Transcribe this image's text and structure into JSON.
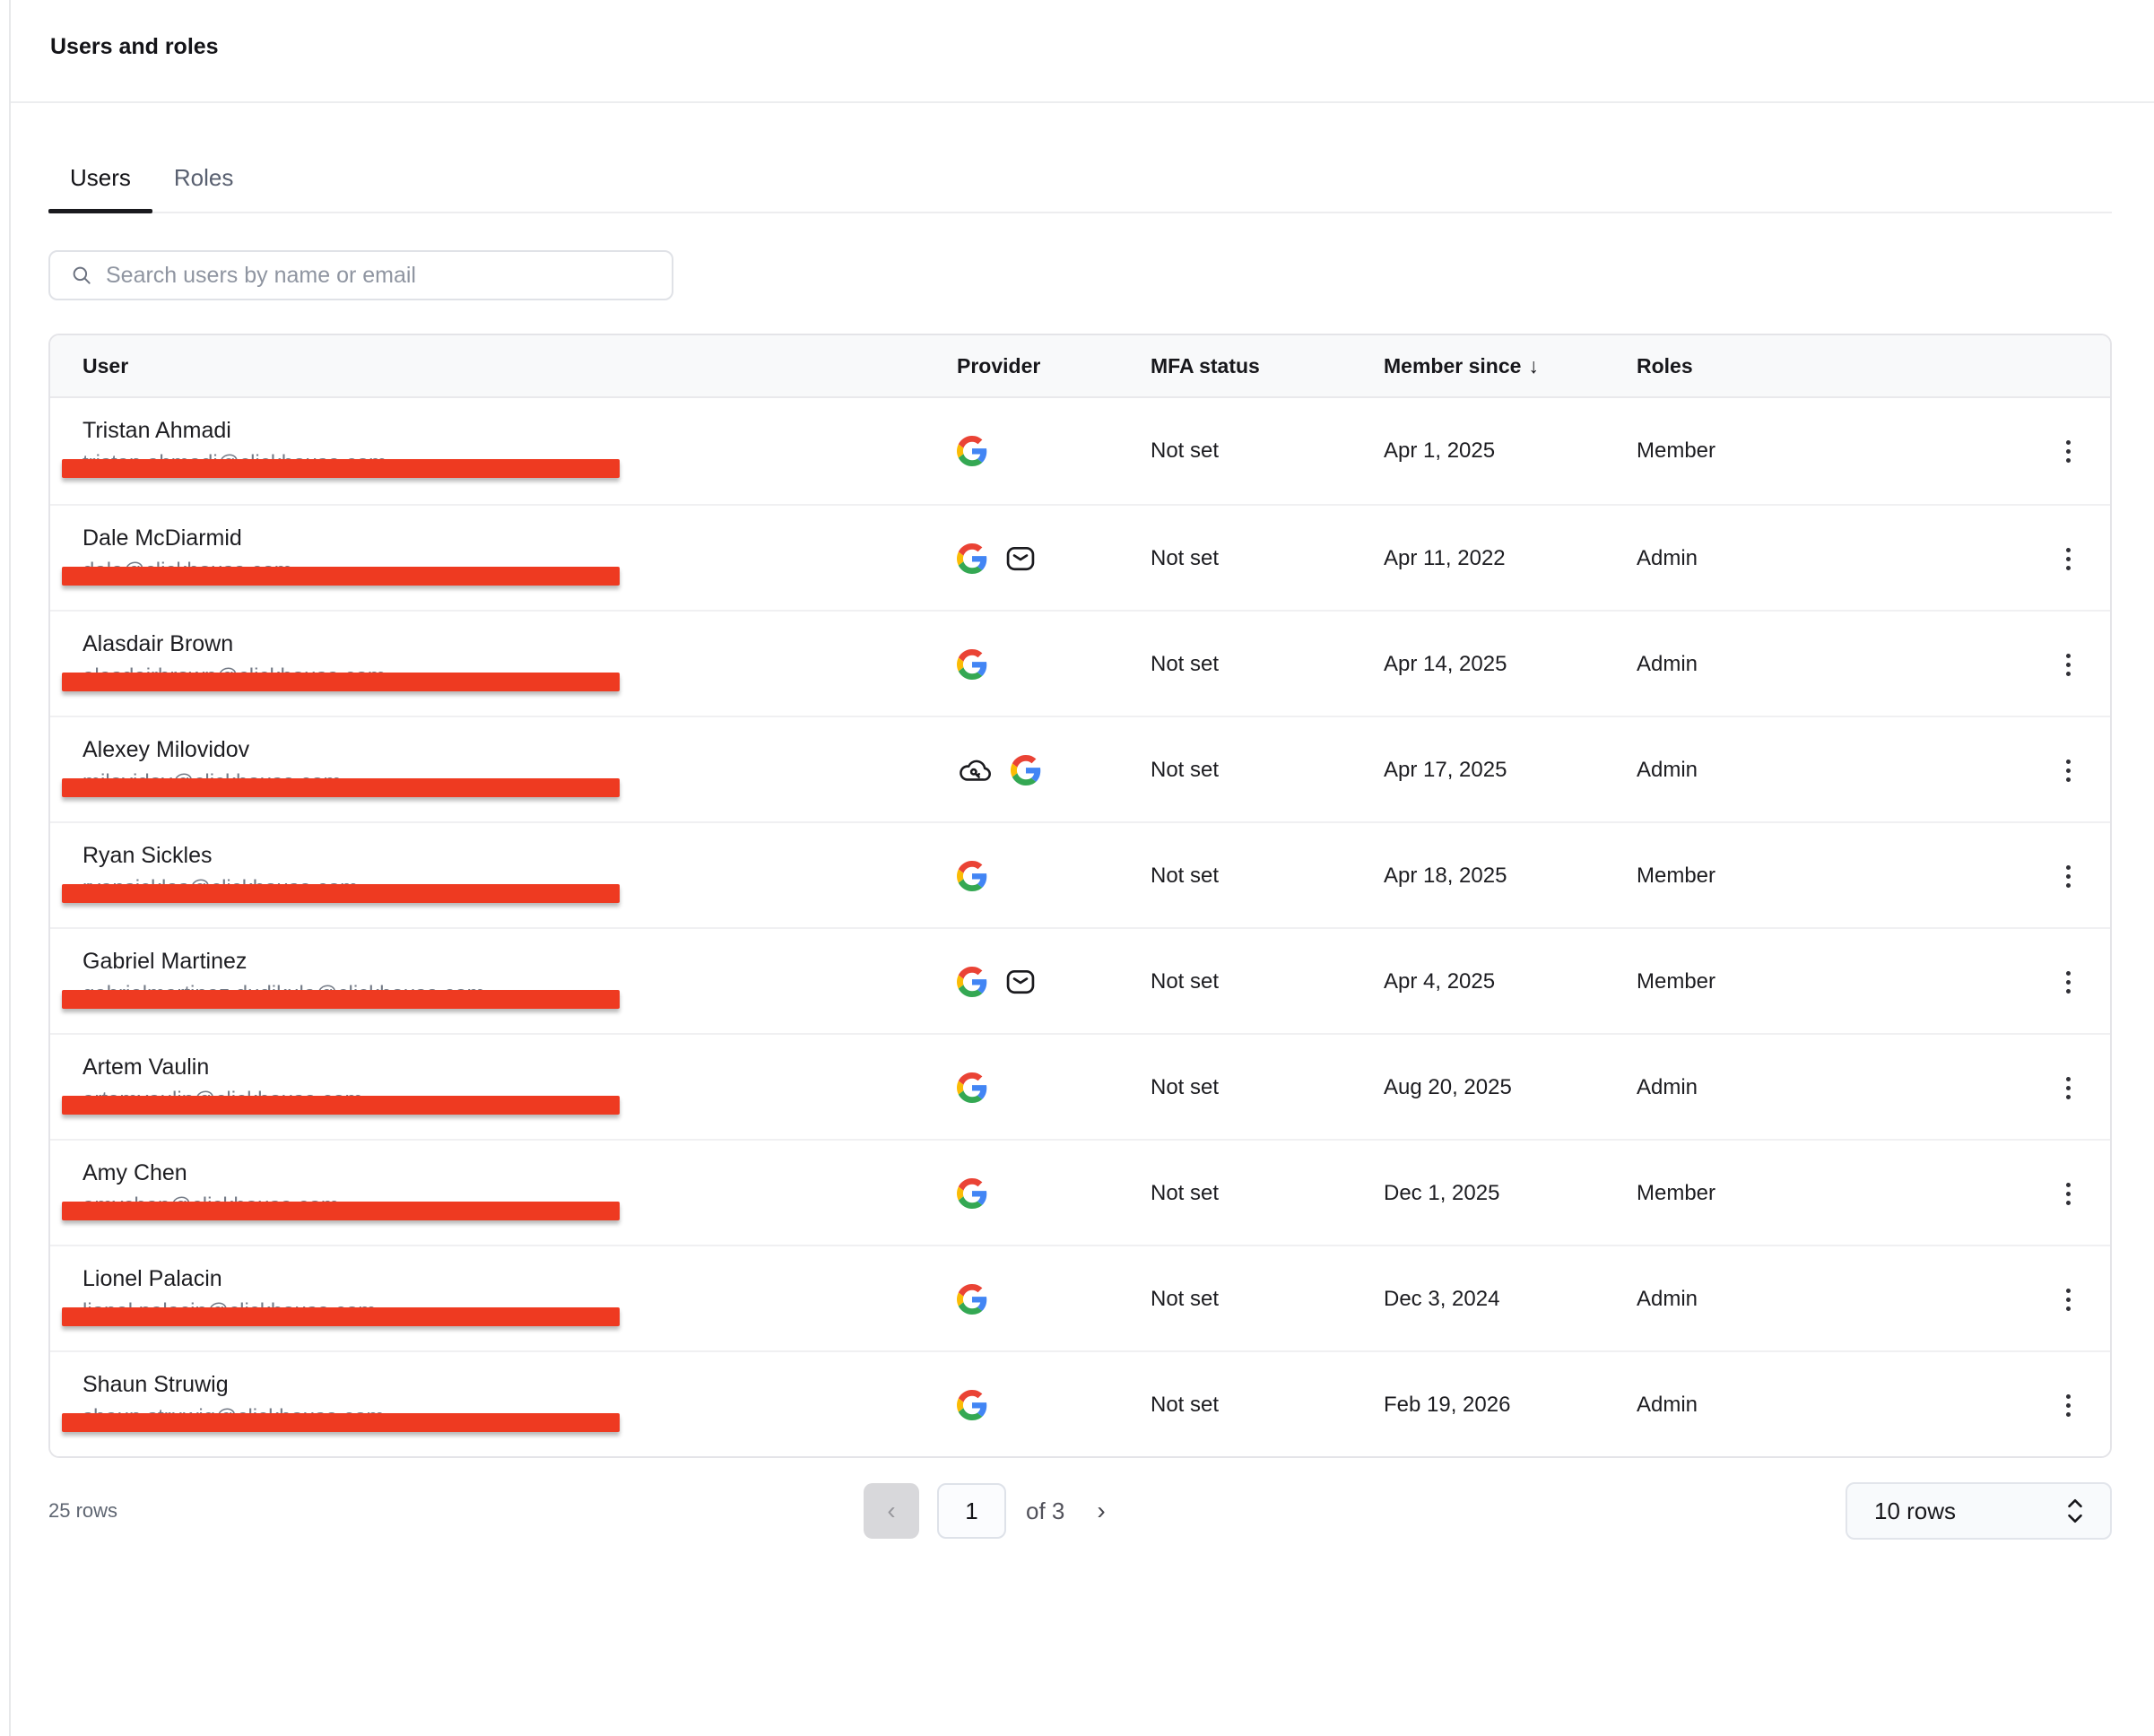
{
  "page": {
    "title": "Users and roles"
  },
  "tabs": [
    {
      "label": "Users",
      "active": true
    },
    {
      "label": "Roles",
      "active": false
    }
  ],
  "search": {
    "placeholder": "Search users by name or email",
    "icon": "search-icon"
  },
  "table": {
    "columns": [
      "User",
      "Provider",
      "MFA status",
      "Member since",
      "Roles"
    ],
    "sort": {
      "column": "Member since",
      "direction": "desc",
      "arrow": "↓"
    },
    "provider_icon_names": {
      "google": "google-icon",
      "email": "envelope-icon",
      "sso": "cloud-key-icon"
    },
    "rows": [
      {
        "name": "Tristan Ahmadi",
        "email": "tristan.ahmadi@clickhouse.com",
        "email_redacted": true,
        "providers": [
          "google"
        ],
        "mfa": "Not set",
        "member_since": "Apr 1, 2025",
        "role": "Member"
      },
      {
        "name": "Dale McDiarmid",
        "email": "dale@clickhouse.com",
        "email_redacted": true,
        "providers": [
          "google",
          "email"
        ],
        "mfa": "Not set",
        "member_since": "Apr 11, 2022",
        "role": "Admin"
      },
      {
        "name": "Alasdair Brown",
        "email": "alasdairbrown@clickhouse.com",
        "email_redacted": true,
        "providers": [
          "google"
        ],
        "mfa": "Not set",
        "member_since": "Apr 14, 2025",
        "role": "Admin"
      },
      {
        "name": "Alexey Milovidov",
        "email": "milovidov@clickhouse.com",
        "email_redacted": true,
        "providers": [
          "sso",
          "google"
        ],
        "mfa": "Not set",
        "member_since": "Apr 17, 2025",
        "role": "Admin"
      },
      {
        "name": "Ryan Sickles",
        "email": "ryansickles@clickhouse.com",
        "email_redacted": true,
        "providers": [
          "google"
        ],
        "mfa": "Not set",
        "member_since": "Apr 18, 2025",
        "role": "Member"
      },
      {
        "name": "Gabriel Martinez",
        "email": "gabrielmartinez.dudikula@clickhouse.com",
        "email_redacted": true,
        "providers": [
          "google",
          "email"
        ],
        "mfa": "Not set",
        "member_since": "Apr 4, 2025",
        "role": "Member"
      },
      {
        "name": "Artem Vaulin",
        "email": "artemvaulin@clickhouse.com",
        "email_redacted": true,
        "providers": [
          "google"
        ],
        "mfa": "Not set",
        "member_since": "Aug 20, 2025",
        "role": "Admin"
      },
      {
        "name": "Amy Chen",
        "email": "amychen@clickhouse.com",
        "email_redacted": true,
        "providers": [
          "google"
        ],
        "mfa": "Not set",
        "member_since": "Dec 1, 2025",
        "role": "Member"
      },
      {
        "name": "Lionel Palacin",
        "email": "lionel.palacin@clickhouse.com",
        "email_redacted": true,
        "providers": [
          "google"
        ],
        "mfa": "Not set",
        "member_since": "Dec 3, 2024",
        "role": "Admin"
      },
      {
        "name": "Shaun Struwig",
        "email": "shaun.struwig@clickhouse.com",
        "email_redacted": true,
        "providers": [
          "google"
        ],
        "mfa": "Not set",
        "member_since": "Feb 19, 2026",
        "role": "Admin"
      }
    ]
  },
  "footer": {
    "total": "25 rows",
    "prev": "‹",
    "page": "1",
    "of": "of 3",
    "next": "›",
    "page_size": "10 rows"
  },
  "colors": {
    "redaction": "#ee3a21",
    "text_primary": "#1d1d21",
    "text_muted": "#5f6672",
    "border": "#e4e4e8",
    "table_header_bg": "#f8f9fa",
    "tab_underline": "#1a1a1e"
  }
}
